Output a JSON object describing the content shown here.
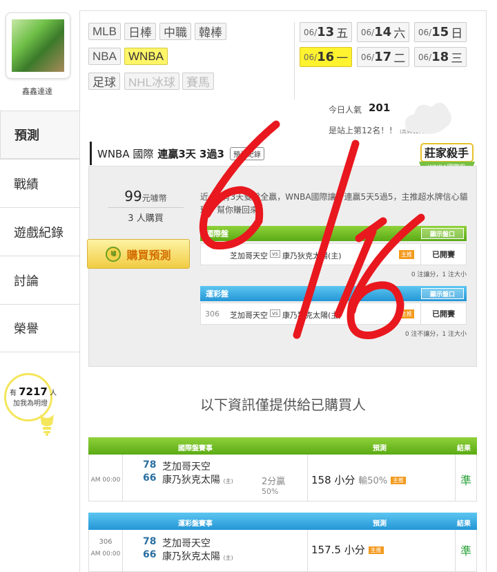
{
  "sidebar": {
    "username": "鑫鑫達達",
    "items": [
      {
        "label": "預測"
      },
      {
        "label": "戰績"
      },
      {
        "label": "遊戲紀錄"
      },
      {
        "label": "討論"
      },
      {
        "label": "榮譽"
      }
    ],
    "lamp": {
      "prefix": "有",
      "count": "7217",
      "suffix": "人",
      "caption": "加我為明燈"
    }
  },
  "leagues": {
    "row1": [
      "MLB",
      "日棒",
      "中職",
      "韓棒"
    ],
    "row2": [
      "NBA",
      "WNBA"
    ],
    "row3": [
      "足球",
      "NHL冰球",
      "賽馬"
    ],
    "active": "WNBA"
  },
  "dates": [
    {
      "month": "06/",
      "day": "13",
      "weekday": "五"
    },
    {
      "month": "06/",
      "day": "14",
      "weekday": "六"
    },
    {
      "month": "06/",
      "day": "15",
      "weekday": "日"
    },
    {
      "month": "06/",
      "day": "16",
      "weekday": "一"
    },
    {
      "month": "06/",
      "day": "17",
      "weekday": "二"
    },
    {
      "month": "06/",
      "day": "18",
      "weekday": "三"
    }
  ],
  "stats": {
    "pop_label": "今日人氣",
    "pop_value": "201",
    "rank_text": "是站上第12名！！",
    "rank_sub": "(共9012人)..."
  },
  "prediction": {
    "title_league": "WNBA 國際",
    "title_streak": "連贏3天 3過3",
    "btn_label": "預測紀錄",
    "badge_top": "莊家殺手",
    "badge_bottom": "WNBA國際盤",
    "price": "99",
    "price_unit": "元噱幣",
    "buyers": "3 人購買",
    "buy_label": "購買預測",
    "buy_icon": "噱",
    "description": "近4日有3天雙盤全贏，WNBA國際讓分連贏5天5過5，主推超水牌信心貓球，幫你賺回來。",
    "intl_table": {
      "head": "國際盤",
      "show_btn": "顯示盤口",
      "home": "芝加哥天空",
      "vs": "vs",
      "away": "康乃狄克太陽(主)",
      "tag": "主推",
      "status": "已開賽",
      "footer": "0 注讓分，1 注大小"
    },
    "lottery_table": {
      "head": "運彩盤",
      "show_btn": "顯示盤口",
      "num": "306",
      "home": "芝加哥天空",
      "vs": "vs",
      "away": "康乃狄克太陽(主)",
      "tag": "主推",
      "status": "已開賽",
      "footer": "0 注不讓分，1 注大小"
    }
  },
  "info_note": "以下資訊僅提供給已購買人",
  "results": {
    "intl": {
      "head_game": "國際盤賽事",
      "head_pred": "預測",
      "head_result": "結果",
      "time": "AM 00:00",
      "score_home": "78",
      "team_home": "芝加哥天空",
      "score_away": "66",
      "team_away": "康乃狄克太陽",
      "host_mark": "(主)",
      "margin": "2分贏",
      "margin_pct": "50%",
      "pred": "158 小分",
      "pred_pct": "輸50%",
      "pred_tag": "主推",
      "result": "準"
    },
    "lottery": {
      "head_game": "運彩盤賽事",
      "head_pred": "預測",
      "head_result": "結果",
      "num": "306",
      "time": "AM 00:00",
      "score_home": "78",
      "team_home": "芝加哥天空",
      "score_away": "66",
      "team_away": "康乃狄克太陽",
      "host_mark": "(主)",
      "pred": "157.5 小分",
      "pred_tag": "主推",
      "result": "準"
    }
  },
  "handwriting": "6/16",
  "colors": {
    "accent_yellow": "#fff22e",
    "green_head": "#6cbf1f",
    "blue_head": "#36a9e1",
    "ink_red": "#e8181e"
  }
}
